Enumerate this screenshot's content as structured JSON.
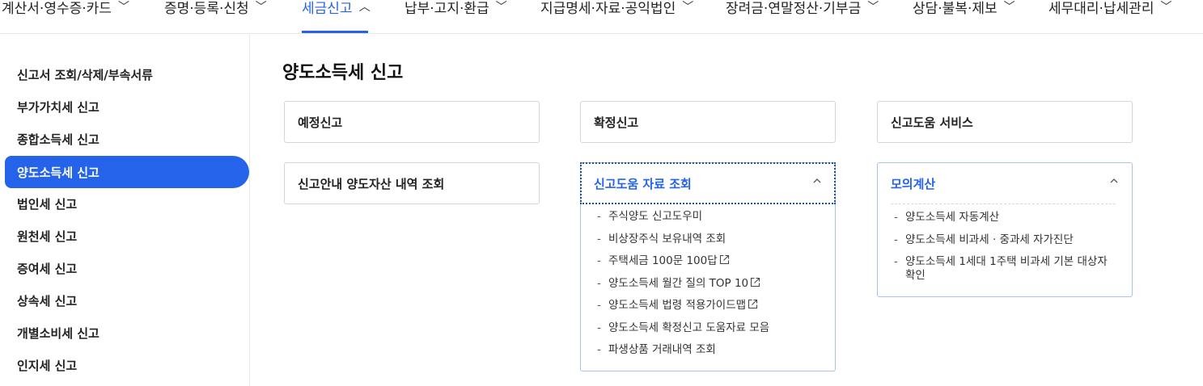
{
  "topnav": {
    "items": [
      {
        "label": "계산서·영수증·카드",
        "active": false
      },
      {
        "label": "증명·등록·신청",
        "active": false
      },
      {
        "label": "세금신고",
        "active": true
      },
      {
        "label": "납부·고지·환급",
        "active": false
      },
      {
        "label": "지급명세·자료·공익법인",
        "active": false
      },
      {
        "label": "장려금·연말정산·기부금",
        "active": false
      },
      {
        "label": "상담·불복·제보",
        "active": false
      },
      {
        "label": "세무대리·납세관리",
        "active": false
      }
    ]
  },
  "sidebar": {
    "items": [
      {
        "label": "신고서 조회/삭제/부속서류",
        "active": false
      },
      {
        "label": "부가가치세 신고",
        "active": false
      },
      {
        "label": "종합소득세 신고",
        "active": false
      },
      {
        "label": "양도소득세 신고",
        "active": true
      },
      {
        "label": "법인세 신고",
        "active": false
      },
      {
        "label": "원천세 신고",
        "active": false
      },
      {
        "label": "증여세 신고",
        "active": false
      },
      {
        "label": "상속세 신고",
        "active": false
      },
      {
        "label": "개별소비세 신고",
        "active": false
      },
      {
        "label": "인지세 신고",
        "active": false
      }
    ]
  },
  "main": {
    "title": "양도소득세 신고",
    "cards": [
      {
        "label": "예정신고"
      },
      {
        "label": "확정신고"
      },
      {
        "label": "신고도움 서비스"
      },
      {
        "label": "신고안내 양도자산 내역 조회"
      },
      {
        "label": "신고도움 자료 조회",
        "links": [
          {
            "label": "주식양도 신고도우미",
            "external": false
          },
          {
            "label": "비상장주식 보유내역 조회",
            "external": false
          },
          {
            "label": "주택세금 100문 100답",
            "external": true
          },
          {
            "label": "양도소득세 월간 질의 TOP 10",
            "external": true
          },
          {
            "label": "양도소득세 법령 적용가이드맵",
            "external": true
          },
          {
            "label": "양도소득세 확정신고 도움자료 모음",
            "external": false
          },
          {
            "label": "파생상품 거래내역 조회",
            "external": false
          }
        ]
      },
      {
        "label": "모의계산",
        "links": [
          {
            "label": "양도소득세 자동계산",
            "external": false
          },
          {
            "label": "양도소득세 비과세 · 중과세 자가진단",
            "external": false
          },
          {
            "label": "양도소득세 1세대 1주택 비과세 기본 대상자 확인",
            "external": false
          }
        ]
      }
    ]
  },
  "colors": {
    "accent": "#2563eb",
    "border": "#cfd6df",
    "text": "#222222"
  },
  "icons": {
    "dropdown": "chevron-down-icon",
    "collapse": "chevron-up-icon",
    "external": "external-link-icon"
  }
}
